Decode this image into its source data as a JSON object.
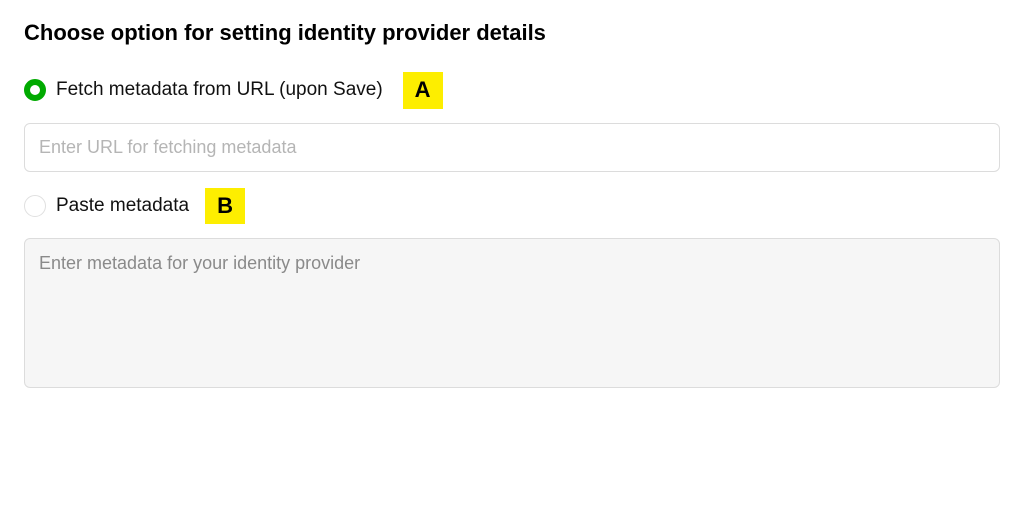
{
  "heading": "Choose option for setting identity provider details",
  "options": {
    "fetch": {
      "label": "Fetch metadata from URL (upon Save)",
      "selected": true,
      "input_placeholder": "Enter URL for fetching metadata",
      "input_value": ""
    },
    "paste": {
      "label": "Paste metadata",
      "selected": false,
      "textarea_placeholder": "Enter metadata for your identity provider",
      "textarea_value": ""
    }
  },
  "annotations": {
    "a": "A",
    "b": "B"
  },
  "colors": {
    "radio_selected": "#00aa00",
    "annotation_bg": "#fdee00"
  }
}
